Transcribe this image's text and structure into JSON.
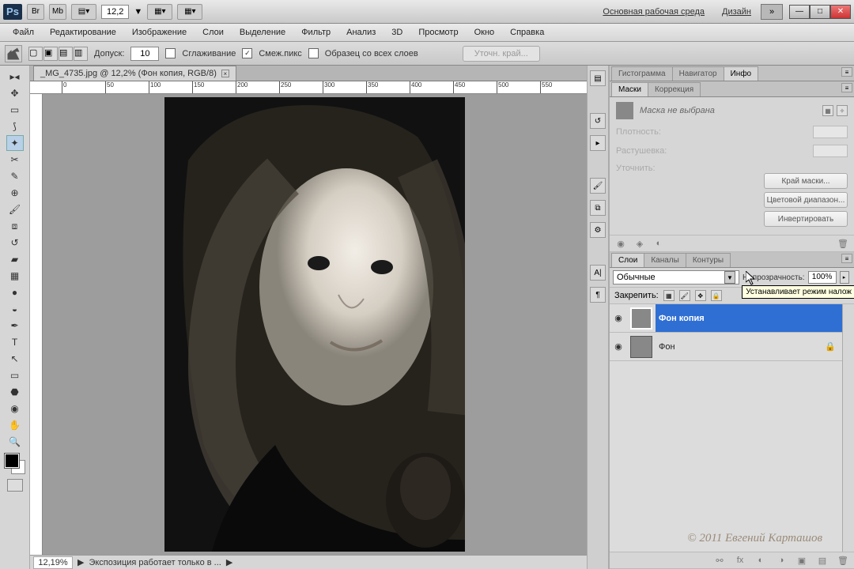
{
  "titlebar": {
    "app_initials": "Ps",
    "br_icon": "Br",
    "mb_icon": "Mb",
    "zoom_display": "12,2",
    "workspace_main": "Основная рабочая среда",
    "workspace_design": "Дизайн"
  },
  "menu": [
    "Файл",
    "Редактирование",
    "Изображение",
    "Слои",
    "Выделение",
    "Фильтр",
    "Анализ",
    "3D",
    "Просмотр",
    "Окно",
    "Справка"
  ],
  "options": {
    "tolerance_label": "Допуск:",
    "tolerance_value": "10",
    "antialias_label": "Сглаживание",
    "antialias_checked": false,
    "contiguous_label": "Смеж.пикс",
    "contiguous_checked": true,
    "all_layers_label": "Образец со всех слоев",
    "all_layers_checked": false,
    "refine_label": "Уточн. край..."
  },
  "document": {
    "tab_title": "_MG_4735.jpg @ 12,2% (Фон копия, RGB/8)",
    "status_zoom": "12,19%",
    "status_text": "Экспозиция работает только в ..."
  },
  "rt_panels": {
    "hist_tabs": [
      "Гистограмма",
      "Навигатор",
      "Инфо"
    ],
    "hist_active": 2,
    "mask_tabs": [
      "Маски",
      "Коррекция"
    ],
    "mask_active": 0,
    "mask_none": "Маска не выбрана",
    "density_label": "Плотность:",
    "feather_label": "Растушевка:",
    "refine_head": "Уточнить:",
    "edge_btn": "Край маски...",
    "range_btn": "Цветовой диапазон...",
    "invert_btn": "Инвертировать",
    "layer_tabs": [
      "Слои",
      "Каналы",
      "Контуры"
    ],
    "layer_active": 0,
    "blend_mode": "Обычные",
    "opacity_label": "Непрозрачность:",
    "opacity_value": "100%",
    "blend_tooltip": "Устанавливает режим налож",
    "lock_label": "Закрепить:",
    "layers": [
      {
        "name": "Фон копия",
        "selected": true,
        "locked": false
      },
      {
        "name": "Фон",
        "selected": false,
        "locked": true
      }
    ]
  },
  "watermark": "© 2011 Евгений Карташов"
}
